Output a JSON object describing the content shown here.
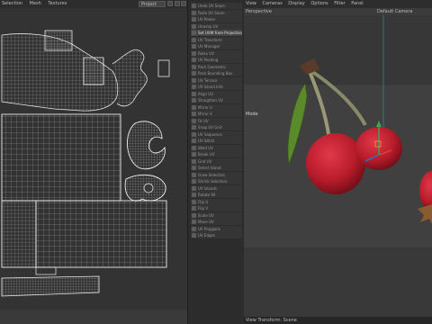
{
  "uv_editor": {
    "menu": [
      "Selection",
      "Mesh",
      "Textures"
    ],
    "projection_dropdown": "Project"
  },
  "commands": [
    {
      "label": "Undo UV Seam",
      "highlight": false
    },
    {
      "label": "Redo UV Seam",
      "highlight": false
    },
    {
      "label": "UV Peeler",
      "highlight": false
    },
    {
      "label": "Unwrap UV",
      "highlight": false
    },
    {
      "label": "Set UVW from Projection",
      "highlight": true
    },
    {
      "label": "UV Transform",
      "highlight": false
    },
    {
      "label": "UV Manager",
      "highlight": false
    },
    {
      "label": "Relax UV",
      "highlight": false
    },
    {
      "label": "UV Packing",
      "highlight": false
    },
    {
      "label": "Pack Geometric",
      "highlight": false
    },
    {
      "label": "Pack Bounding Box",
      "highlight": false
    },
    {
      "label": "UV Terrace",
      "highlight": false
    },
    {
      "label": "UV Island Info",
      "highlight": false
    },
    {
      "label": "Align UV",
      "highlight": false
    },
    {
      "label": "Straighten UV",
      "highlight": false
    },
    {
      "label": "Mirror U",
      "highlight": false
    },
    {
      "label": "Mirror V",
      "highlight": false
    },
    {
      "label": "Fit UV",
      "highlight": false
    },
    {
      "label": "Snap UV Grid",
      "highlight": false
    },
    {
      "label": "UV Sequence",
      "highlight": false
    },
    {
      "label": "UV Stitch",
      "highlight": false
    },
    {
      "label": "Weld UV",
      "highlight": false
    },
    {
      "label": "Break UV",
      "highlight": false
    },
    {
      "label": "Grid UV",
      "highlight": false
    },
    {
      "label": "Select Island",
      "highlight": false
    },
    {
      "label": "Grow Selection",
      "highlight": false
    },
    {
      "label": "Shrink Selection",
      "highlight": false
    },
    {
      "label": "UV Islands",
      "highlight": false
    },
    {
      "label": "Rotate 90",
      "highlight": false
    },
    {
      "label": "Flip U",
      "highlight": false
    },
    {
      "label": "Flip V",
      "highlight": false
    },
    {
      "label": "Scale UV",
      "highlight": false
    },
    {
      "label": "Move UV",
      "highlight": false
    },
    {
      "label": "UV Polygons",
      "highlight": false
    },
    {
      "label": "UV Edges",
      "highlight": false
    }
  ],
  "viewport": {
    "menu": [
      "View",
      "Cameras",
      "Display",
      "Options",
      "Filter",
      "Panel"
    ],
    "projection": "Perspective",
    "camera": "Default Camera",
    "mode": "Mode",
    "status": "View Transform: Scene"
  },
  "colors": {
    "cherry": "#c0212f",
    "leaf": "#5a8a2a",
    "stem": "#8a8a6a",
    "accent": "#2f7fd6"
  }
}
